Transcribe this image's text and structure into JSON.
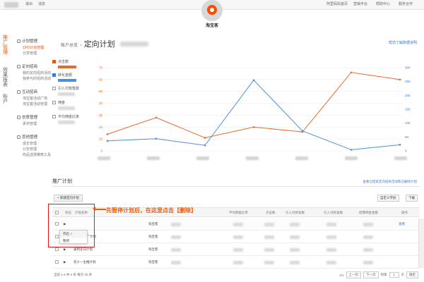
{
  "topbar": {
    "links": [
      "退出",
      "消息"
    ],
    "right_links": [
      "阿里妈妈首页",
      "营销平台",
      "帮助中心",
      "服务合作"
    ]
  },
  "logo": {
    "text": "淘宝客"
  },
  "side_vertical": {
    "active": "推广管理",
    "others": [
      "效果报表",
      "账户"
    ]
  },
  "menu": [
    {
      "head": "计划管理",
      "items": [
        {
          "label": "CPS计划管理",
          "active": true
        },
        {
          "label": "分享管理",
          "active": false
        }
      ]
    },
    {
      "head": "定向招商",
      "items": [
        {
          "label": "我的定向招商活动",
          "active": false
        },
        {
          "label": "我参与的招商活动",
          "active": false
        }
      ]
    },
    {
      "head": "互动招商",
      "items": [
        {
          "label": "淘宝客活动广场",
          "active": false
        },
        {
          "label": "淘宝客活动管理",
          "active": false
        }
      ]
    },
    {
      "head": "创意管理",
      "items": [
        {
          "label": "素材管理",
          "active": false
        }
      ]
    },
    {
      "head": "其他管理",
      "items": [
        {
          "label": "成长管理",
          "active": false
        },
        {
          "label": "公告管理",
          "active": false
        },
        {
          "label": "商品选择推荐工具",
          "active": false
        }
      ]
    }
  ],
  "breadcrumb": {
    "home": "账户总览",
    "sep": "›",
    "title": "定向计划"
  },
  "help_link": "帮您了解数据说明",
  "legend": {
    "items": [
      "点击数",
      "转化金额",
      "引入付款笔数",
      "佣金",
      "平均佣金比率"
    ]
  },
  "chart_data": {
    "type": "line",
    "ylim_left": [
      0,
      70
    ],
    "ylim_right": [
      0,
      300
    ],
    "y_ticks_left": [
      0,
      10,
      20,
      30,
      40,
      50,
      60,
      70
    ],
    "y_ticks_right": [
      0,
      50,
      100,
      150,
      200,
      250,
      300
    ],
    "series": [
      {
        "axis": "left",
        "color": "#e8692e",
        "values": [
          14,
          28,
          11,
          20,
          16,
          66,
          60
        ]
      },
      {
        "axis": "right",
        "color": "#4a90d9",
        "values": [
          36,
          44,
          20,
          255,
          72,
          4,
          22
        ]
      }
    ]
  },
  "section": {
    "title": "推广计划",
    "link": "查看已结束定向招商活动和已删除计划"
  },
  "buttons": {
    "new": "+ 新建定向计划",
    "right1": "自定义字段",
    "right2": "下载"
  },
  "table": {
    "headers": [
      "状态",
      "计划名称",
      "平均佣金比率",
      "点击数",
      "引入付款笔数",
      "引入付款金额",
      "结算佣金金额",
      "操作"
    ],
    "rows": [
      {
        "type": "淘宝客",
        "name": "",
        "op": "查看"
      },
      {
        "type": "淘宝客",
        "name": "推广计划",
        "op": ""
      },
      {
        "type": "淘宝客",
        "name": "通用定向计划",
        "op": ""
      },
      {
        "type": "淘宝客",
        "name": "双十一主推计划",
        "op": ""
      }
    ]
  },
  "dropdown": {
    "items": [
      "开启",
      "暂停"
    ]
  },
  "annotation": {
    "text": "先暂停计划后，在这里点击【删除】"
  },
  "footer": {
    "left": "当前 1-4 共 4 条   每页 20 条",
    "page_info": "1/1",
    "prev": "上一页",
    "next": "下一页",
    "goto_label": "到第",
    "goto_value": "1",
    "goto_unit": "页",
    "confirm": "确定"
  }
}
